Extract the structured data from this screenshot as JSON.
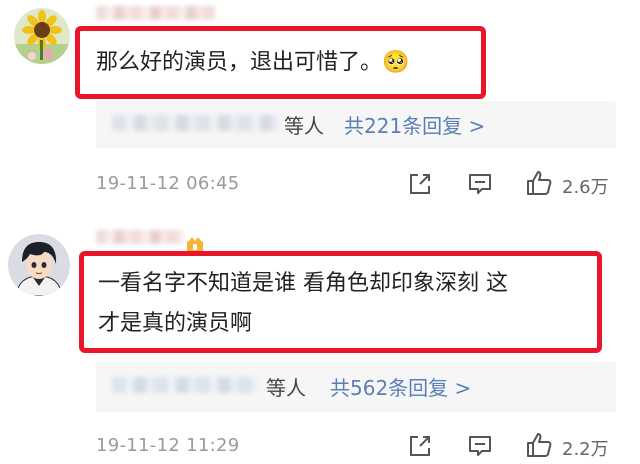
{
  "comments": [
    {
      "text": "那么好的演员，退出可惜了。🥺",
      "reply_suffix": "等人",
      "reply_total": "共221条回复 >",
      "timestamp": "19-11-12 06:45",
      "likes": "2.6万",
      "avatar_icon": "sunflower-avatar"
    },
    {
      "text_line1": "一看名字不知道是谁 看角色却印象深刻 这",
      "text_line2": "才是真的演员啊",
      "reply_suffix": "等人",
      "reply_total": "共562条回复 >",
      "timestamp": "19-11-12 11:29",
      "likes": "2.2万",
      "avatar_icon": "anime-boy-avatar"
    }
  ],
  "icons": {
    "share": "share-icon",
    "comment": "comment-icon",
    "like": "thumbs-up-icon",
    "badge": "vip-badge-icon"
  },
  "colors": {
    "highlight_border": "#e8152b",
    "link_blue": "#5a7fb4",
    "timestamp_gray": "#9a9a9a"
  }
}
